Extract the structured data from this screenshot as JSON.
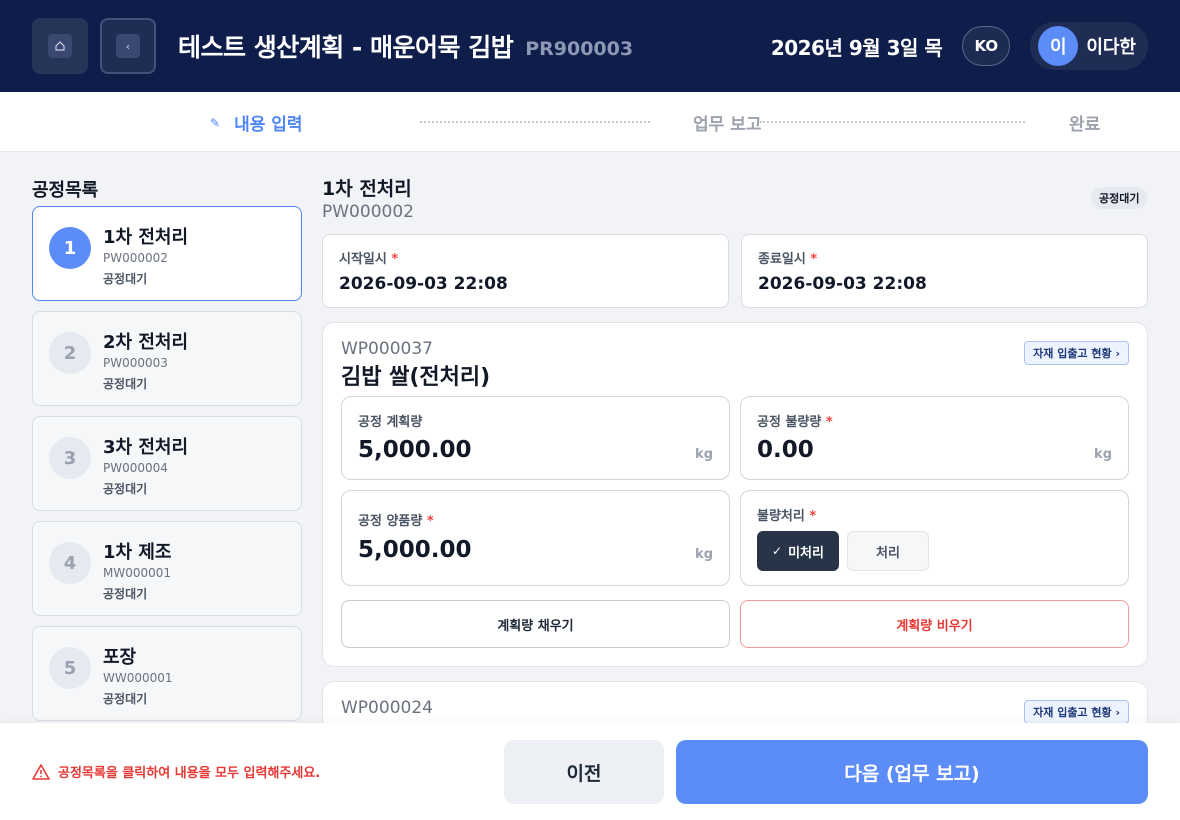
{
  "header": {
    "home_icon": "home-icon",
    "back_icon": "chevron-left-icon",
    "title": "테스트 생산계획 - 매운어묵 김밥",
    "plan_code": "PR900003",
    "date": "2026년 9월 3일 목",
    "language": "KO",
    "user": {
      "avatar_initial": "이",
      "name": "이다한"
    }
  },
  "stepper": {
    "steps": [
      {
        "label": "내용 입력",
        "state": "active",
        "icon": "pencil-icon"
      },
      {
        "label": "업무 보고",
        "state": "pending"
      },
      {
        "label": "완료",
        "state": "pending"
      }
    ]
  },
  "sidebar": {
    "title": "공정목록",
    "processes": [
      {
        "num": "1",
        "name": "1차 전처리",
        "code": "PW000002",
        "status": "공정대기",
        "selected": true
      },
      {
        "num": "2",
        "name": "2차 전처리",
        "code": "PW000003",
        "status": "공정대기",
        "selected": false
      },
      {
        "num": "3",
        "name": "3차 전처리",
        "code": "PW000004",
        "status": "공정대기",
        "selected": false
      },
      {
        "num": "4",
        "name": "1차 제조",
        "code": "MW000001",
        "status": "공정대기",
        "selected": false
      },
      {
        "num": "5",
        "name": "포장",
        "code": "WW000001",
        "status": "공정대기",
        "selected": false
      }
    ]
  },
  "main": {
    "title": "1차 전처리",
    "code": "PW000002",
    "status_badge": "공정대기",
    "start": {
      "label": "시작일시",
      "value": "2026-09-03 22:08"
    },
    "end": {
      "label": "종료일시",
      "value": "2026-09-03 22:08"
    },
    "required_mark": "*",
    "work_products": [
      {
        "code": "WP000037",
        "name": "김밥 쌀(전처리)",
        "stock_button": "자재 입출고 현황 ›",
        "planned": {
          "label": "공정 계획량",
          "value": "5,000.00",
          "unit": "kg"
        },
        "defect": {
          "label": "공정 불량량",
          "value": "0.00",
          "unit": "kg"
        },
        "good": {
          "label": "공정 양품량",
          "value": "5,000.00",
          "unit": "kg"
        },
        "defect_handling": {
          "label": "불량처리",
          "options": [
            "미처리",
            "처리"
          ],
          "selected": "미처리"
        },
        "fill_button": "계획량 채우기",
        "clear_button": "계획량 비우기"
      },
      {
        "code": "WP000024",
        "stock_button": "자재 입출고 현황 ›"
      }
    ]
  },
  "footer": {
    "warning": "공정목록을 클릭하여 내용을 모두 입력해주세요.",
    "prev_button": "이전",
    "next_button": "다음 (업무 보고)"
  },
  "colors": {
    "header_bg": "#0e1d4a",
    "accent": "#5b8cf8",
    "danger": "#e53935",
    "selected_toggle": "#283548"
  }
}
